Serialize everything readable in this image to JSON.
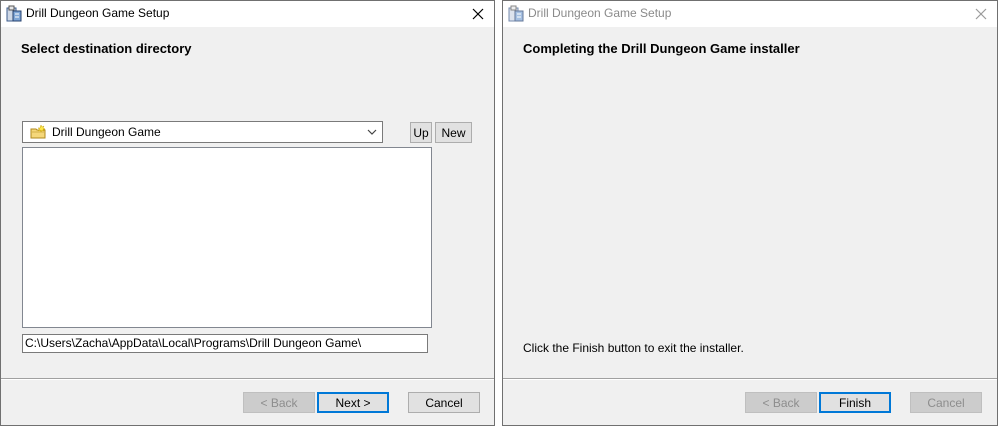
{
  "left_window": {
    "title": "Drill Dungeon Game Setup",
    "heading": "Select destination directory",
    "directory_combo": {
      "selected": "Drill Dungeon Game"
    },
    "up_label": "Up",
    "new_label": "New",
    "path_value": "C:\\Users\\Zacha\\AppData\\Local\\Programs\\Drill Dungeon Game\\",
    "back_label": "< Back",
    "next_label": "Next >",
    "cancel_label": "Cancel"
  },
  "right_window": {
    "title": "Drill Dungeon Game Setup",
    "heading": "Completing the Drill Dungeon Game installer",
    "message": "Click the Finish button to exit the installer.",
    "back_label": "< Back",
    "finish_label": "Finish",
    "cancel_label": "Cancel"
  },
  "icons": {
    "app": "installer-icon",
    "close": "close-icon",
    "folder": "folder-new-icon",
    "dropdown": "chevron-down-icon"
  },
  "colors": {
    "dialog_bg": "#f0f0f0",
    "default_button_border": "#0078d7",
    "disabled_text": "#8d8d8d"
  }
}
